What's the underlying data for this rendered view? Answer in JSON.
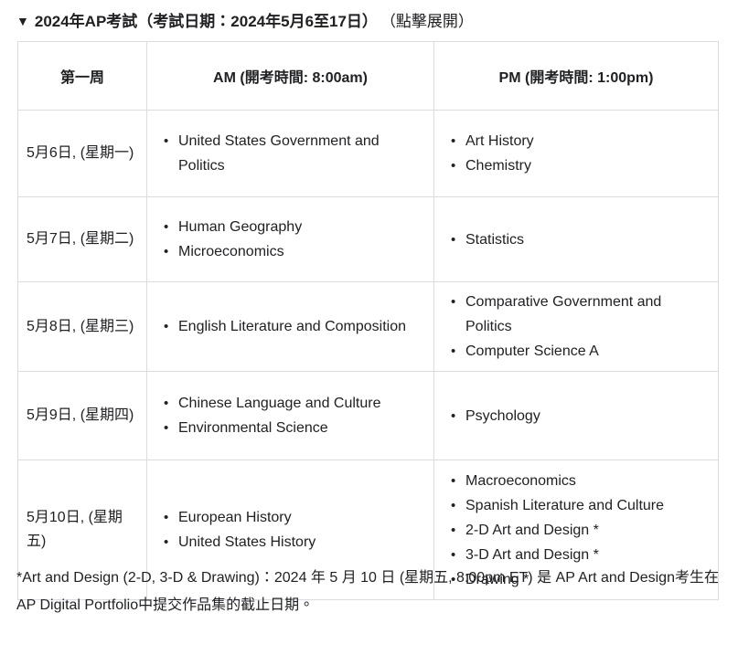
{
  "summary": {
    "triangle_icon": "▼",
    "title": "2024年AP考試（考試日期：2024年5月6至17日）",
    "hint": "（點擊展開）"
  },
  "table": {
    "headers": {
      "week": "第一周",
      "am": "AM (開考時間: 8:00am)",
      "pm": "PM (開考時間: 1:00pm)"
    },
    "rows": [
      {
        "day": "5月6日, (星期一)",
        "am": [
          "United States Government and Politics"
        ],
        "pm": [
          "Art History",
          "Chemistry"
        ]
      },
      {
        "day": "5月7日, (星期二)",
        "am": [
          "Human Geography",
          "Microeconomics"
        ],
        "pm": [
          "Statistics"
        ]
      },
      {
        "day": "5月8日, (星期三)",
        "am": [
          "English Literature and Composition"
        ],
        "pm": [
          "Comparative Government and Politics",
          "Computer Science A"
        ]
      },
      {
        "day": "5月9日, (星期四)",
        "am": [
          "Chinese Language and Culture",
          "Environmental Science"
        ],
        "pm": [
          "Psychology"
        ]
      },
      {
        "day": "5月10日, (星期五)",
        "am": [
          "European History",
          "United States History"
        ],
        "pm": [
          "Macroeconomics",
          "Spanish Literature and Culture",
          "2-D Art and Design *",
          "3-D Art and Design *",
          "Drawing *"
        ]
      }
    ]
  },
  "footnote": {
    "text": "*Art and Design (2-D, 3-D & Drawing)：2024 年 5 月 10 日 (星期五, 8:00pm ET) 是 AP Art and Design考生在 AP Digital Portfolio中提交作品集的截止日期。"
  },
  "colors": {
    "text": "#202124",
    "border": "#dadce0",
    "background": "#ffffff"
  }
}
